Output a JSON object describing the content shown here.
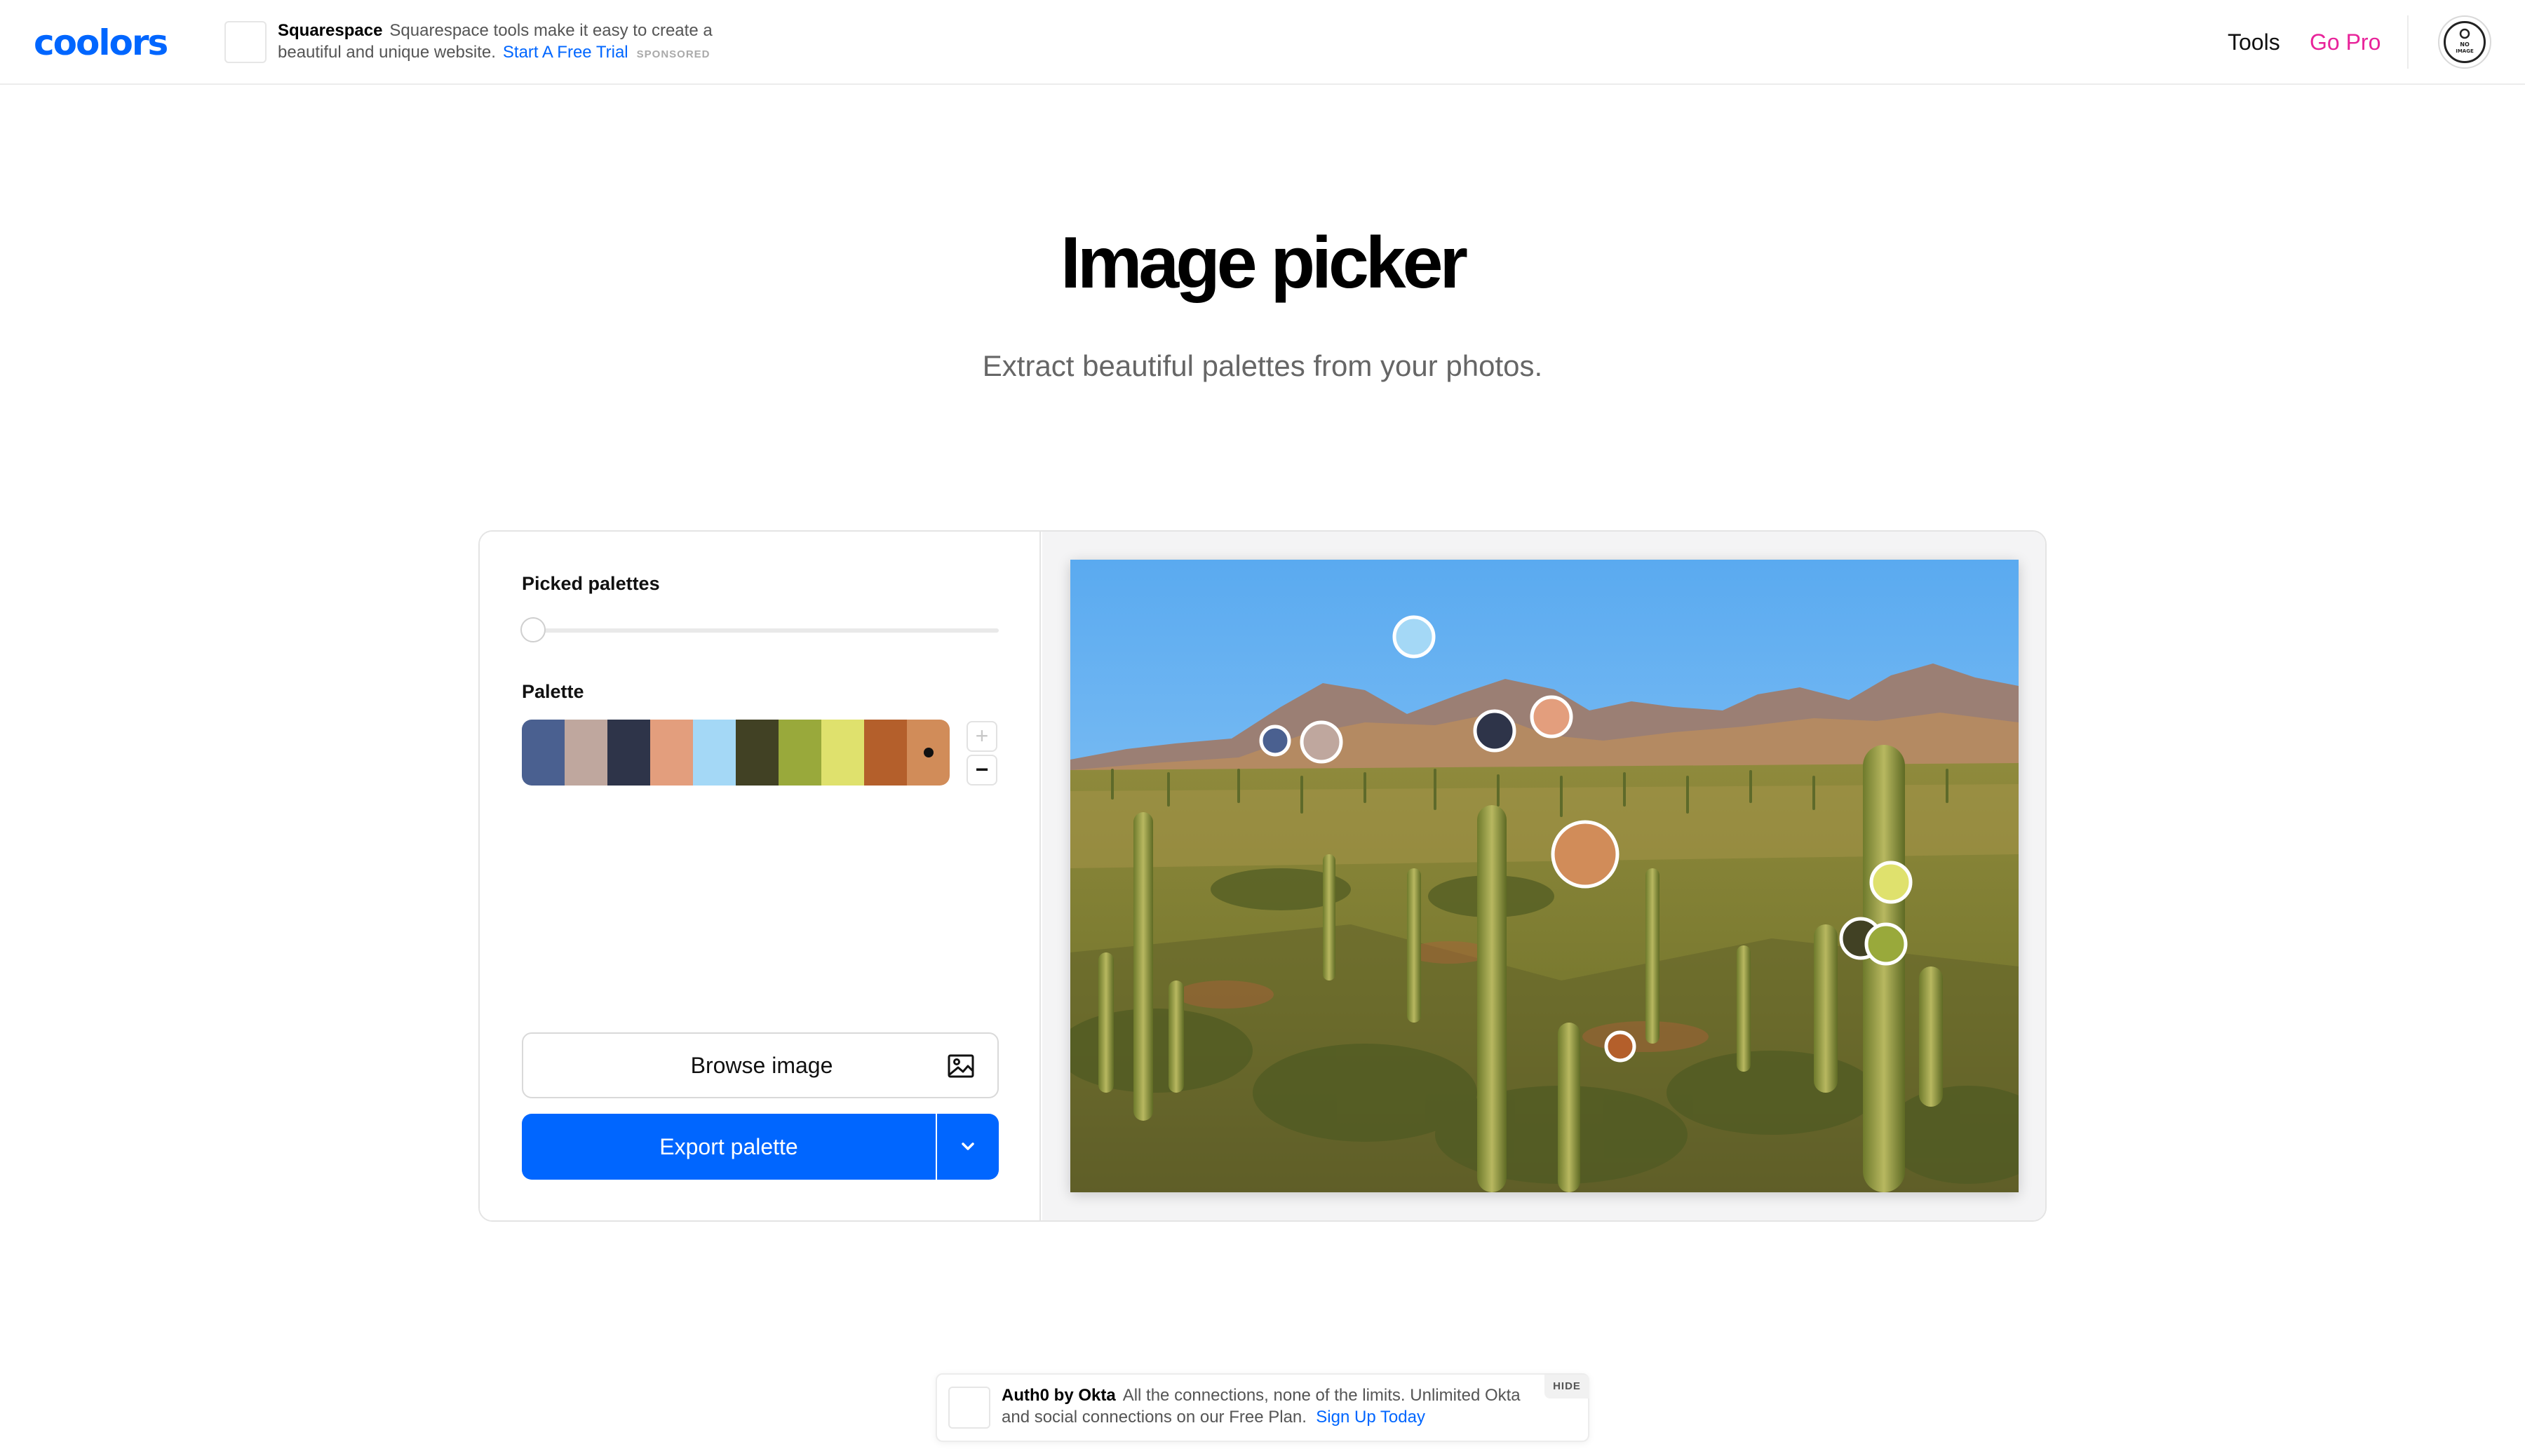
{
  "header": {
    "logo": "coolors",
    "ad": {
      "brand": "Squarespace",
      "text": "Squarespace tools make it easy to create a beautiful and unique website.",
      "link": "Start A Free Trial",
      "sponsored": "SPONSORED"
    },
    "nav": {
      "tools": "Tools",
      "go_pro": "Go Pro"
    },
    "avatar": {
      "line1": "NO",
      "line2": "IMAGE"
    }
  },
  "hero": {
    "title": "Image picker",
    "subtitle": "Extract beautiful palettes from your photos."
  },
  "picker_panel": {
    "picked_palettes_label": "Picked palettes",
    "palette_label": "Palette",
    "palette_colors": [
      "#4a6090",
      "#bfa79e",
      "#2e3449",
      "#e39e7d",
      "#a4d8f6",
      "#414124",
      "#99a93b",
      "#dfe16d",
      "#b45f2b",
      "#d18c59"
    ],
    "plus_label": "+",
    "minus_label": "−",
    "browse_label": "Browse image",
    "export_label": "Export palette",
    "icons": {
      "browse": "image-icon",
      "export_more": "chevron-down-icon"
    }
  },
  "ad_bottom": {
    "brand": "Auth0 by Okta",
    "text": "All the connections, none of the limits. Unlimited Okta and social connections on our Free Plan.",
    "link": "Sign Up Today",
    "hide": "HIDE"
  },
  "colors": {
    "accent": "#0066ff",
    "pro": "#e8239a"
  }
}
